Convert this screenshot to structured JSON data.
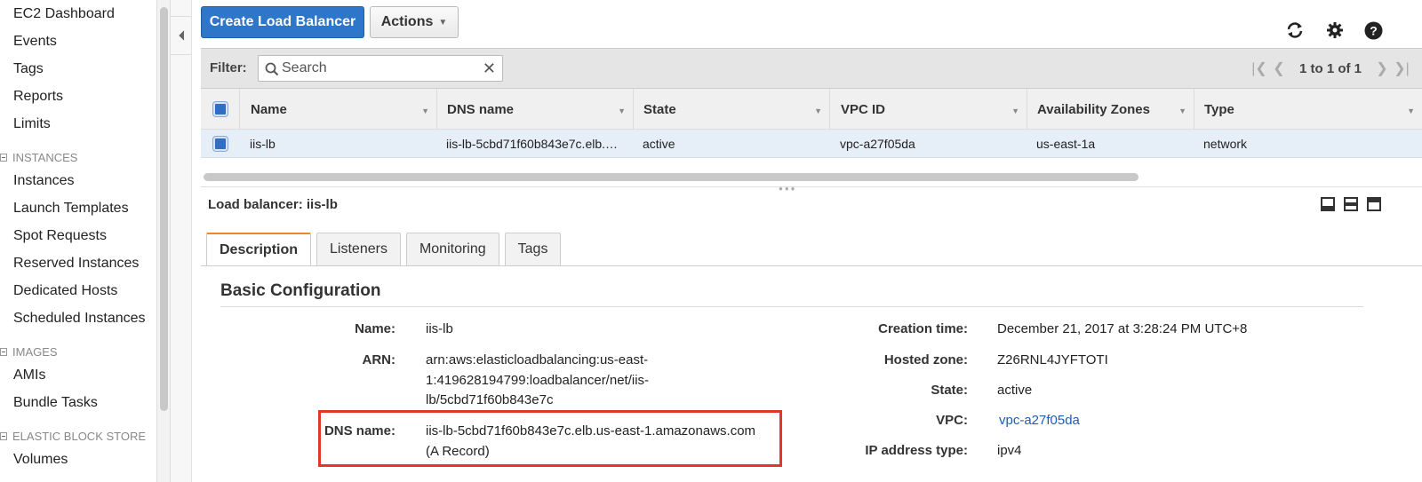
{
  "sidebar": {
    "items_top": [
      "EC2 Dashboard",
      "Events",
      "Tags",
      "Reports",
      "Limits"
    ],
    "section_instances": "INSTANCES",
    "items_instances": [
      "Instances",
      "Launch Templates",
      "Spot Requests",
      "Reserved Instances",
      "Dedicated Hosts",
      "Scheduled Instances"
    ],
    "section_images": "IMAGES",
    "items_images": [
      "AMIs",
      "Bundle Tasks"
    ],
    "section_ebs": "ELASTIC BLOCK STORE",
    "items_ebs": [
      "Volumes"
    ]
  },
  "toolbar": {
    "create_label": "Create Load Balancer",
    "actions_label": "Actions",
    "icons": [
      "refresh-icon",
      "gear-icon",
      "help-icon"
    ]
  },
  "filter": {
    "label": "Filter:",
    "placeholder": "Search",
    "value": "",
    "pager_text": "1 to 1 of 1"
  },
  "table": {
    "columns": [
      "Name",
      "DNS name",
      "State",
      "VPC ID",
      "Availability Zones",
      "Type"
    ],
    "rows": [
      [
        "iis-lb",
        "iis-lb-5cbd71f60b843e7c.elb.…",
        "active",
        "vpc-a27f05da",
        "us-east-1a",
        "network"
      ]
    ]
  },
  "detail": {
    "title": "Load balancer: iis-lb",
    "tabs": [
      "Description",
      "Listeners",
      "Monitoring",
      "Tags"
    ],
    "active_tab": "Description",
    "section_title": "Basic Configuration",
    "left": {
      "name_label": "Name:",
      "name_value": "iis-lb",
      "arn_label": "ARN:",
      "arn_lines": [
        "arn:aws:elasticloadbalancing:us-east-",
        "1:419628194799:loadbalancer/net/iis-",
        "lb/5cbd71f60b843e7c"
      ],
      "dns_label": "DNS name:",
      "dns_lines": [
        "iis-lb-5cbd71f60b843e7c.elb.us-east-1.amazonaws.com",
        "(A Record)"
      ]
    },
    "right": {
      "creation_label": "Creation time:",
      "creation_value": "December 21, 2017 at 3:28:24 PM UTC+8",
      "zone_label": "Hosted zone:",
      "zone_value": "Z26RNL4JYFTOTI",
      "state_label": "State:",
      "state_value": "active",
      "vpc_label": "VPC:",
      "vpc_value": "vpc-a27f05da",
      "ip_label": "IP address type:",
      "ip_value": "ipv4"
    }
  },
  "colors": {
    "primary": "#2e76c9",
    "highlight_box": "#e0382a",
    "link": "#1a5fb4",
    "tab_accent": "#e9892a"
  }
}
